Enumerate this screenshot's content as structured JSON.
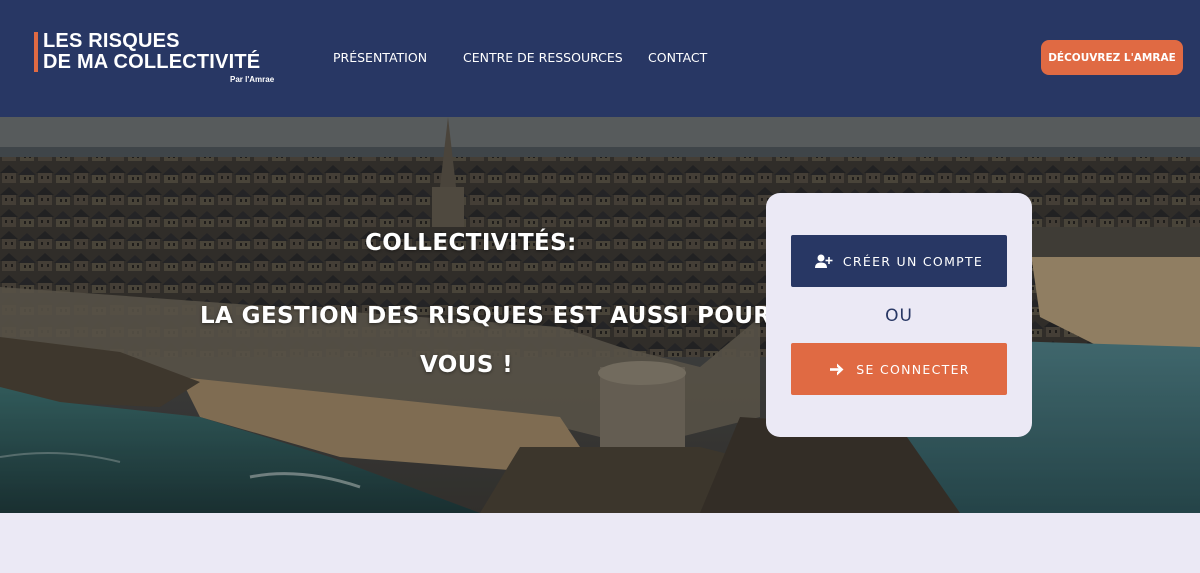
{
  "logo": {
    "line1": "LES RISQUES",
    "line2": "DE MA COLLECTIVITÉ",
    "sub": "Par l'Amrae"
  },
  "nav": {
    "items": [
      {
        "label": "PRÉSENTATION"
      },
      {
        "label": "CENTRE DE RESSOURCES"
      },
      {
        "label": "CONTACT"
      }
    ],
    "cta_label": "DÉCOUVREZ L'AMRAE"
  },
  "hero": {
    "title_line1": "COLLECTIVITÉS:",
    "title_line2": "LA GESTION DES RISQUES EST AUSSI POUR",
    "title_line3": "VOUS !",
    "background_icon": "aerial-photo-walled-city"
  },
  "auth": {
    "create_label": "CRÉER UN COMPTE",
    "create_icon": "user-plus-icon",
    "or_label": "OU",
    "login_label": "SE CONNECTER",
    "login_icon": "arrow-right-icon"
  },
  "colors": {
    "primary": "#283764",
    "accent": "#e06a43",
    "light": "#ebe9f5"
  }
}
